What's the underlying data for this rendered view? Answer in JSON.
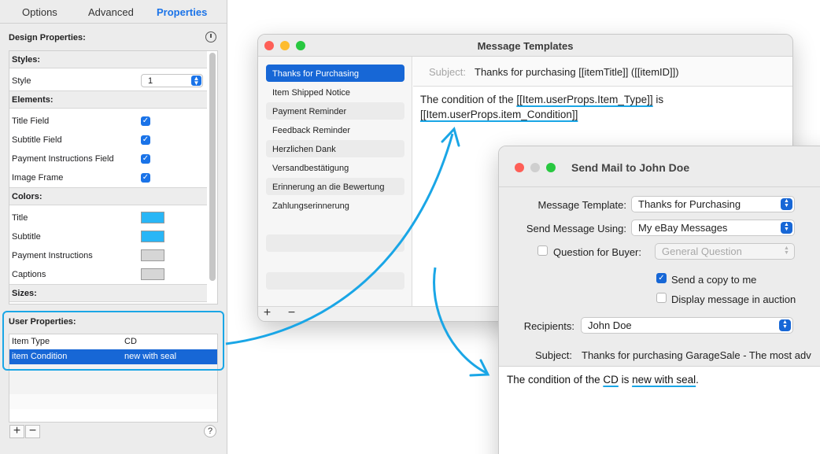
{
  "inspector": {
    "tabs": [
      "Options",
      "Advanced",
      "Properties"
    ],
    "design_title": "Design Properties:",
    "groups": {
      "styles": "Styles:",
      "elements": "Elements:",
      "colors": "Colors:",
      "sizes": "Sizes:"
    },
    "style_label": "Style",
    "style_value": "1",
    "elements": [
      "Title Field",
      "Subtitle Field",
      "Payment Instructions Field",
      "Image Frame"
    ],
    "colors": [
      {
        "label": "Title",
        "color": "#29b6f6"
      },
      {
        "label": "Subtitle",
        "color": "#29b6f6"
      },
      {
        "label": "Payment Instructions",
        "color": "#d6d6d6"
      },
      {
        "label": "Captions",
        "color": "#d6d6d6"
      }
    ],
    "user_title": "User Properties:",
    "user_props": [
      {
        "key": "Item Type",
        "value": "CD"
      },
      {
        "key": "item Condition",
        "value": "new with seal"
      }
    ],
    "add": "+",
    "remove": "−",
    "help": "?"
  },
  "templates_window": {
    "title": "Message Templates",
    "templates": [
      "Thanks for Purchasing",
      "Item Shipped Notice",
      "Payment Reminder",
      "Feedback Reminder",
      "Herzlichen Dank",
      "Versandbestätigung",
      "Erinnerung an die Bewertung",
      "Zahlungserinnerung"
    ],
    "subject_label": "Subject:",
    "subject_value": "Thanks for purchasing [[itemTitle]] ([[itemID]])",
    "body_pre": "The condition of the ",
    "body_tok1": "[[Item.userProps.Item_Type]]",
    "body_mid": " is",
    "body_tok2": "[[Item.userProps.item_Condition]]",
    "add": "+",
    "remove": "−"
  },
  "sendmail_window": {
    "title": "Send Mail to John Doe",
    "template_label": "Message Template:",
    "template_value": "Thanks for Purchasing",
    "using_label": "Send Message Using:",
    "using_value": "My eBay Messages",
    "question_label": "Question for Buyer:",
    "question_value": "General Question",
    "copy_label": "Send a copy to me",
    "display_label": "Display message in auction",
    "recipients_label": "Recipients:",
    "recipients_value": "John Doe",
    "subject_label": "Subject:",
    "subject_value": "Thanks for purchasing GarageSale - The most adv",
    "body_pre": "The condition of the ",
    "body_val1": "CD",
    "body_mid": " is ",
    "body_val2": "new with seal",
    "body_end": "."
  },
  "colors": {
    "accent": "#1767d6",
    "annotation": "#1aa6e6"
  }
}
